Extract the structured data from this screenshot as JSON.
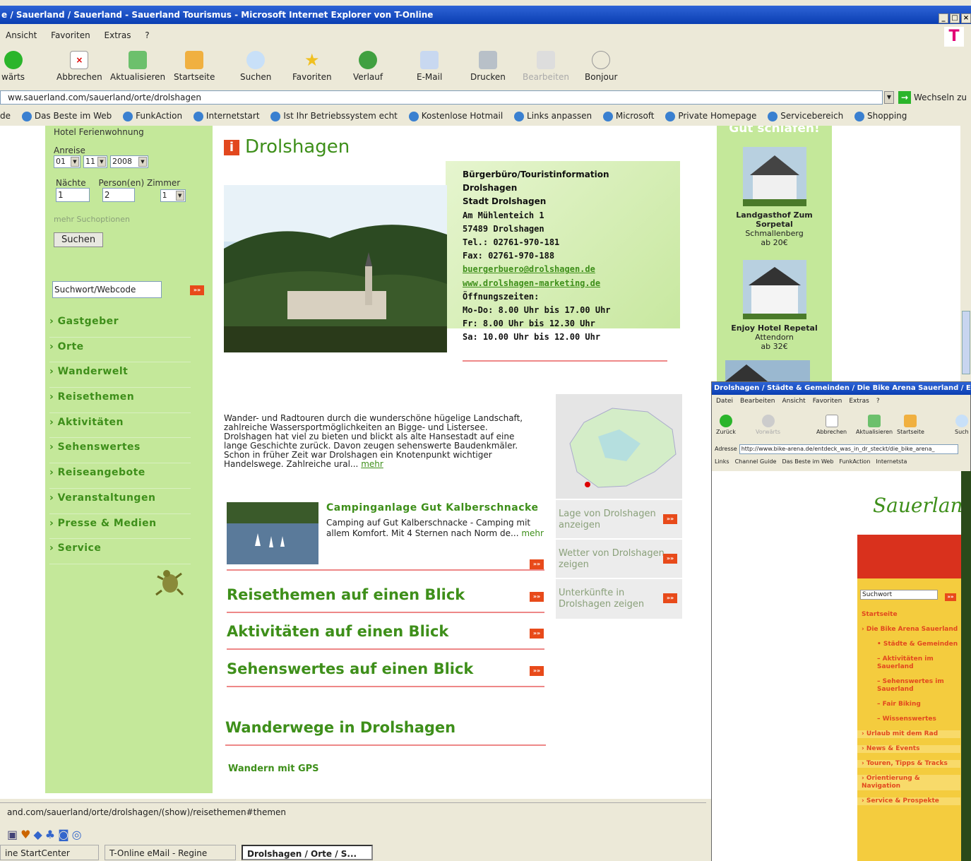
{
  "window": {
    "title": "e / Sauerland / Sauerland - Sauerland Tourismus - Microsoft Internet Explorer von T-Online",
    "controls": [
      "_",
      "□",
      "×"
    ]
  },
  "menu": [
    "Ansicht",
    "Favoriten",
    "Extras",
    "?"
  ],
  "brand_logo": "T",
  "toolbar": [
    {
      "label": "wärts",
      "icon": "forward-icon"
    },
    {
      "label": "Abbrechen",
      "icon": "stop-icon"
    },
    {
      "label": "Aktualisieren",
      "icon": "refresh-icon"
    },
    {
      "label": "Startseite",
      "icon": "home-icon"
    },
    {
      "label": "Suchen",
      "icon": "search-icon"
    },
    {
      "label": "Favoriten",
      "icon": "star-icon"
    },
    {
      "label": "Verlauf",
      "icon": "history-icon"
    },
    {
      "label": "E-Mail",
      "icon": "mail-icon"
    },
    {
      "label": "Drucken",
      "icon": "print-icon"
    },
    {
      "label": "Bearbeiten",
      "icon": "edit-icon"
    },
    {
      "label": "Bonjour",
      "icon": "bonjour-icon"
    }
  ],
  "address": {
    "url": "ww.sauerland.com/sauerland/orte/drolshagen",
    "go_label": "Wechseln zu"
  },
  "links": [
    "de",
    "Das Beste im Web",
    "FunkAction",
    "Internetstart",
    "Ist Ihr Betriebssystem echt",
    "Kostenlose Hotmail",
    "Links anpassen",
    "Microsoft",
    "Private Homepage",
    "Servicebereich",
    "Shopping"
  ],
  "booking": {
    "types": "Hotel   Ferienwohnung",
    "anreise_label": "Anreise",
    "day": "01",
    "month": "11",
    "year": "2008",
    "naechte_label": "Nächte",
    "personen_label": "Person(en)",
    "zimmer_label": "Zimmer",
    "naechte": "1",
    "personen": "2",
    "zimmer": "1",
    "more_options": "mehr Suchoptionen",
    "search_button": "Suchen",
    "keyword_placeholder": "Suchwort/Webcode"
  },
  "nav": [
    "› Gastgeber",
    "› Orte",
    "› Wanderwelt",
    "› Reisethemen",
    "› Aktivitäten",
    "› Sehenswertes",
    "› Reiseangebote",
    "› Veranstaltungen",
    "› Presse & Medien",
    "› Service"
  ],
  "main": {
    "title_icon": "i",
    "title": "Drolshagen",
    "contact": {
      "line1": "Bürgerbüro/Touristinformation",
      "line2": "Drolshagen",
      "line3": "Stadt Drolshagen",
      "line4": "Am Mühlenteich 1",
      "line5": "57489 Drolshagen",
      "tel": "Tel.: 02761-970-181",
      "fax": "Fax: 02761-970-188",
      "email": "buergerbuero@drolshagen.de",
      "web": "www.drolshagen-marketing.de",
      "hours_label": "Öffnungszeiten:",
      "hours1": "Mo-Do: 8.00 Uhr bis 17.00 Uhr",
      "hours2": "Fr: 8.00 Uhr bis 12.30 Uhr",
      "hours3": "Sa: 10.00 Uhr bis 12.00 Uhr"
    },
    "intro": "Wander- und Radtouren durch die wunderschöne hügelige Landschaft, zahlreiche Wassersportmöglichkeiten an Bigge- und Listersee. Drolshagen hat viel zu bieten und blickt als alte Hansestadt auf eine lange Geschichte zurück. Davon zeugen sehenswerte Baudenkmäler. Schon in früher Zeit war Drolshagen ein Knotenpunkt wichtiger Handelswege. Zahlreiche ural...",
    "intro_more": "mehr",
    "camping": {
      "title": "Campinganlage Gut Kalberschnacke",
      "text": "Camping auf Gut Kalberschnacke - Camping mit allem Komfort. Mit 4 Sternen nach Norm de...",
      "more": "mehr"
    },
    "blicks": [
      "Reisethemen auf einen Blick",
      "Aktivitäten auf einen Blick",
      "Sehenswertes auf einen Blick"
    ],
    "wander_title": "Wanderwege in Drolshagen",
    "wander_gps": "Wandern mit GPS",
    "go_glyph": "»»"
  },
  "side": {
    "link1": "Lage von Drolshagen anzeigen",
    "link2": "Wetter von Drolshagen zeigen",
    "link3": "Unterkünfte in Drolshagen zeigen"
  },
  "right": {
    "heading": "Gut schlafen!",
    "hotels": [
      {
        "name": "Landgasthof Zum Sorpetal",
        "town": "Schmallenberg",
        "price": "ab 20€"
      },
      {
        "name": "Enjoy Hotel Repetal",
        "town": "Attendorn",
        "price": "ab 32€"
      }
    ]
  },
  "win2": {
    "title": "Drolshagen / Städte & Gemeinden / Die Bike Arena Sauerland / Entdec",
    "menu": [
      "Datei",
      "Bearbeiten",
      "Ansicht",
      "Favoriten",
      "Extras",
      "?"
    ],
    "toolbar": [
      "Zurück",
      "Vorwärts",
      "Abbrechen",
      "Aktualisieren",
      "Startseite",
      "Such"
    ],
    "address_label": "Adresse",
    "url": "http://www.bike-arena.de/entdeck_was_in_dr_steckt/die_bike_arena_",
    "links_label": "Links",
    "links": [
      "Channel Guide",
      "Das Beste im Web",
      "FunkAction",
      "Internetsta"
    ],
    "logo": "Sauerland",
    "search": "Suchwort",
    "nav": [
      {
        "text": "Startseite",
        "cls": ""
      },
      {
        "text": "› Die Bike Arena Sauerland",
        "cls": ""
      },
      {
        "text": "• Städte & Gemeinden",
        "cls": "sub"
      },
      {
        "text": "– Aktivitäten im Sauerland",
        "cls": "sub"
      },
      {
        "text": "– Sehenswertes im Sauerland",
        "cls": "sub"
      },
      {
        "text": "– Fair Biking",
        "cls": "sub"
      },
      {
        "text": "– Wissenswertes",
        "cls": "sub"
      },
      {
        "text": "› Urlaub mit dem Rad",
        "cls": "grp"
      },
      {
        "text": "› News & Events",
        "cls": "grp"
      },
      {
        "text": "› Touren, Tipps & Tracks",
        "cls": "grp"
      },
      {
        "text": "› Orientierung & Navigation",
        "cls": "grp"
      },
      {
        "text": "› Service & Prospekte",
        "cls": "grp"
      }
    ]
  },
  "status": "and.com/sauerland/orte/drolshagen/(show)/reisethemen#themen",
  "taskbar": [
    {
      "label": "ine StartCenter",
      "active": false
    },
    {
      "label": "T-Online eMail - Regine",
      "active": false
    },
    {
      "label": "Drolshagen / Orte / S...",
      "active": true
    }
  ],
  "colors": {
    "green": "#3e8f1a",
    "lightgreen": "#c4e89a",
    "accent": "#e2481e",
    "xp_blue": "#0a3eb2"
  }
}
